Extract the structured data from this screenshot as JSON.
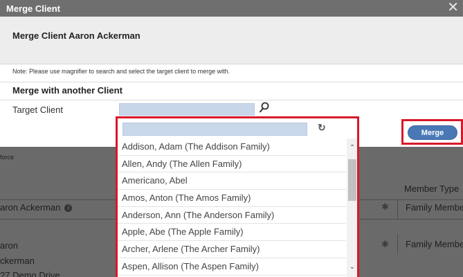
{
  "modal": {
    "title": "Merge Client",
    "close_glyph": "✕",
    "heading": "Merge Client Aaron Ackerman",
    "note": "Note: Please use magnifier to search and select the target client to merge with.",
    "section_title": "Merge with another Client",
    "target_label": "Target Client",
    "target_value": "",
    "merge_label": "Merge"
  },
  "dropdown": {
    "search_value": "",
    "items": [
      "Addison, Adam (The Addison Family)",
      "Allen, Andy (The Allen Family)",
      "Americano, Abel",
      "Amos, Anton (The Amos Family)",
      "Anderson, Ann (The Anderson Family)",
      "Apple, Abe (The Apple Family)",
      "Archer, Arlene (The Archer Family)",
      "Aspen, Allison (The Aspen Family)"
    ]
  },
  "background": {
    "force_text": "force",
    "member_type_header": "Member Type",
    "row1_name": "aron Ackerman",
    "row1_type": "Family Membe",
    "row2_name_line1": "aron",
    "row2_name_line2": "ckerman",
    "row2_name_line3": "?7 Demo Drive",
    "row2_type": "Family Membe"
  },
  "colors": {
    "highlight": "#d8182a",
    "button": "#4a78b6",
    "input": "#c9d7ea"
  },
  "icons": {
    "magnifier": "magnifier-icon",
    "refresh": "refresh-icon",
    "gear": "gear-icon",
    "info": "info-icon",
    "close": "close-icon"
  }
}
